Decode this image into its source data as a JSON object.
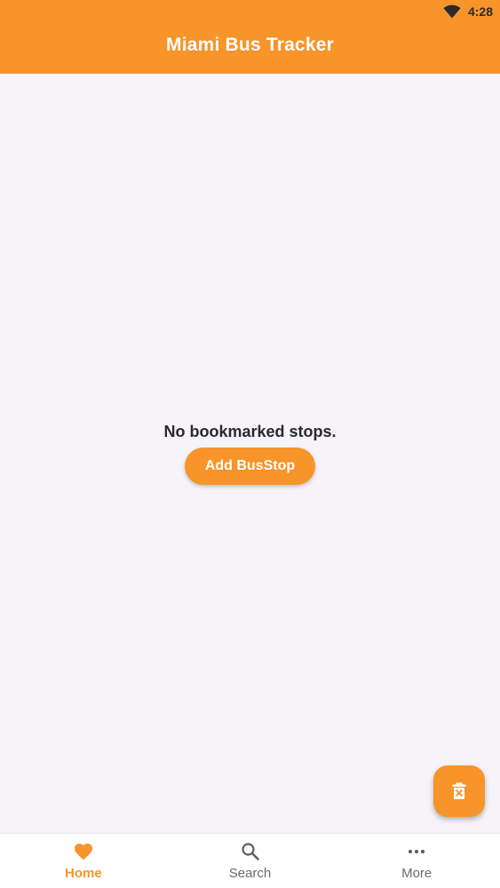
{
  "status_bar": {
    "time": "4:28"
  },
  "app_bar": {
    "title": "Miami Bus Tracker"
  },
  "main": {
    "empty_message": "No bookmarked stops.",
    "add_button_label": "Add BusStop"
  },
  "bottom_nav": {
    "items": [
      {
        "label": "Home",
        "icon": "heart-icon",
        "active": true
      },
      {
        "label": "Search",
        "icon": "search-icon",
        "active": false
      },
      {
        "label": "More",
        "icon": "more-dots-icon",
        "active": false
      }
    ]
  },
  "colors": {
    "accent": "#f7942a",
    "background": "#f6f4f8",
    "inactive_label": "#6b6b6b"
  }
}
